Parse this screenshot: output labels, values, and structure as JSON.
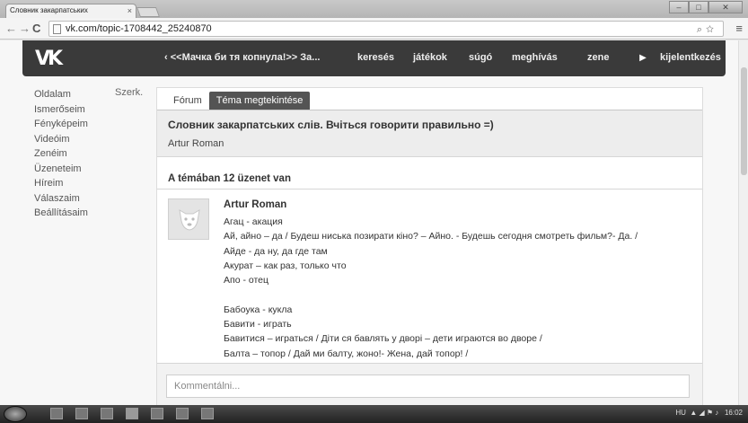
{
  "browser": {
    "tab_title": "Словник закарпатських",
    "tab_close": "×",
    "url": "vk.com/topic-1708442_25240870"
  },
  "header": {
    "logo": "VK",
    "back_link": "‹ <<Мачка би тя копнула!>> За...",
    "nav": [
      "keresés",
      "játékok",
      "súgó",
      "meghívás",
      "zene"
    ],
    "next_arrow": "▶",
    "logout": "kijelentkezés"
  },
  "sidebar": {
    "items": [
      "Oldalam",
      "Ismerőseim",
      "Fényképeim",
      "Videóim",
      "Zenéim",
      "Üzeneteim",
      "Híreim",
      "Válaszaim",
      "Beállításaim"
    ],
    "edit": "Szerk."
  },
  "tabs": [
    "Fórum",
    "Téma megtekintése"
  ],
  "topic": {
    "title": "Словник закарпатських слів. Вчіться говорити правильно =)",
    "author": "Artur Roman"
  },
  "message_count": "A témában 12 üzenet van",
  "post": {
    "author": "Artur Roman",
    "lines": [
      "Агац - акация",
      "Ай, айно – да / Будеш ниська позирати кіно? – Айно. - Будешь сегодня смотреть фильм?- Да. /",
      "Айде - да ну, да где там",
      "Акурат – как раз, только что",
      "Апо - отец",
      "",
      "Бабоука - кукла",
      "Бавити - играть",
      "Бавитися – играться / Діти ся бавлять у дворі – дети играются во дворе /",
      "Балта – топор / Дай ми балту, жоно!- Жена, дай топор! /"
    ]
  },
  "comment": {
    "placeholder": "Kommentálni..."
  },
  "taskbar": {
    "tray_text": "HU",
    "clock": "16:02"
  }
}
